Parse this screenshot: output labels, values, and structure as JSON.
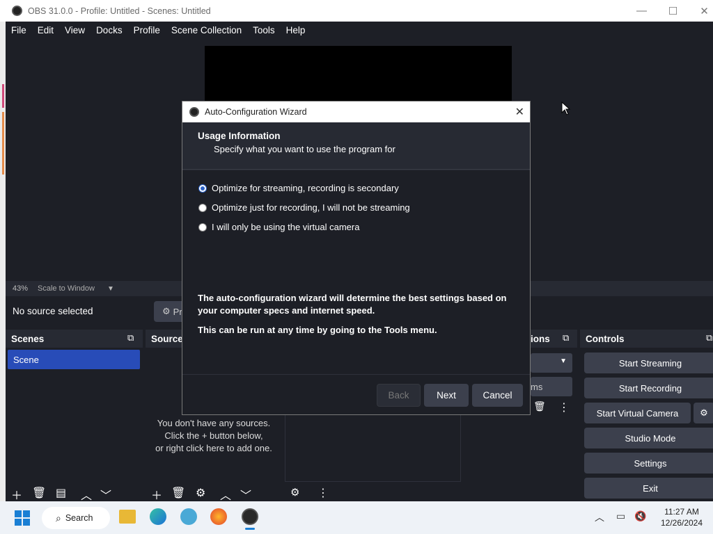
{
  "window": {
    "title": "OBS 31.0.0 - Profile: Untitled - Scenes: Untitled",
    "minimize": "—",
    "maximize": "☐",
    "close": "✕"
  },
  "menu": [
    "File",
    "Edit",
    "View",
    "Docks",
    "Profile",
    "Scene Collection",
    "Tools",
    "Help"
  ],
  "preview": {
    "zoom": "43%",
    "scale_mode": "Scale to Window"
  },
  "source_bar": {
    "no_source": "No source selected",
    "properties_label": "Pr"
  },
  "docks": {
    "scenes": {
      "title": "Scenes",
      "items": [
        "Scene"
      ]
    },
    "sources": {
      "title": "Sources",
      "empty_text_1": "You don't have any sources.",
      "empty_text_2": "Click the + button below,",
      "empty_text_3": "or right click here to add one."
    },
    "transitions": {
      "title": "Scene Transitions",
      "visible_title": "ions",
      "duration_suffix": "ms"
    },
    "controls": {
      "title": "Controls",
      "start_streaming": "Start Streaming",
      "start_recording": "Start Recording",
      "start_virtual_camera": "Start Virtual Camera",
      "studio_mode": "Studio Mode",
      "settings": "Settings",
      "exit": "Exit"
    }
  },
  "dialog": {
    "title": "Auto-Configuration Wizard",
    "heading": "Usage Information",
    "subheading": "Specify what you want to use the program for",
    "options": [
      {
        "label": "Optimize for streaming, recording is secondary",
        "selected": true
      },
      {
        "label": "Optimize just for recording, I will not be streaming",
        "selected": false
      },
      {
        "label": "I will only be using the virtual camera",
        "selected": false
      }
    ],
    "info1": "The auto-configuration wizard will determine the best settings based on your computer specs and internet speed.",
    "info2": "This can be run at any time by going to the Tools menu.",
    "buttons": {
      "back": "Back",
      "next": "Next",
      "cancel": "Cancel"
    }
  },
  "taskbar": {
    "search": "Search",
    "time": "11:27 AM",
    "date": "12/26/2024"
  },
  "colors": {
    "panel_bg": "#1d1f26",
    "header_bg": "#272a33",
    "button_bg": "#3c404d",
    "selection": "#284cb8",
    "accent": "#2a62c9"
  }
}
